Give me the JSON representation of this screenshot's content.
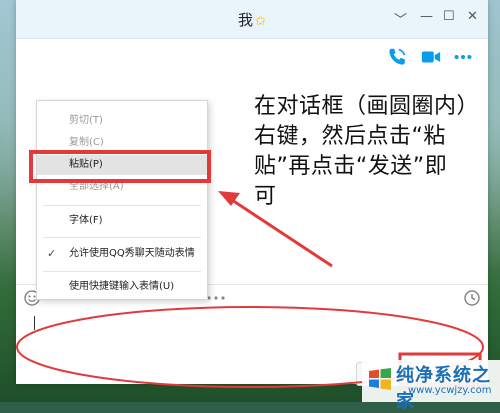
{
  "window": {
    "title": "我",
    "title_icon": "star-icon",
    "controls": {
      "dropdown": "﹀",
      "minimize": "—",
      "maximize": "☐",
      "close": "✕"
    }
  },
  "call_bar": {
    "icons": [
      "phone-icon",
      "video-icon",
      "more-icon"
    ],
    "accent": "#0a9de8"
  },
  "context_menu": {
    "items": [
      {
        "label": "剪切(T)",
        "state": "disabled"
      },
      {
        "label": "复制(C)",
        "state": "disabled"
      },
      {
        "label": "粘贴(P)",
        "state": "highlighted"
      },
      {
        "label": "全部选择(A)",
        "state": "disabled"
      },
      {
        "label": "字体(F)",
        "state": "normal"
      },
      {
        "label": "允许使用QQ秀聊天随动表情",
        "state": "checked"
      },
      {
        "label": "使用快捷键输入表情(U)",
        "state": "normal"
      }
    ]
  },
  "annotation": {
    "lines": [
      "在对话框（画圆圈内）",
      "右键，然后点击“粘",
      "贴”再点击“发送”即",
      "可"
    ],
    "color": "#e23a3a"
  },
  "toolbar": {
    "icons": [
      "emoji-icon",
      "more-dots-icon",
      "history-clock-icon"
    ]
  },
  "watermark": {
    "name": "纯净系统之家",
    "url": "www.ycwjzy.com"
  }
}
